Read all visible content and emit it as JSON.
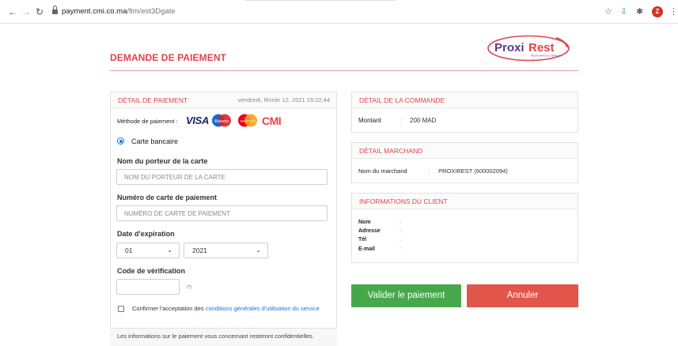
{
  "browser": {
    "url_host": "payment.cmi.co.ma",
    "url_path": "/fim/est3Dgate",
    "avatar_letter": "Z"
  },
  "header": {
    "title": "DEMANDE DE PAIEMENT",
    "logo_text_proxi": "Proxi",
    "logo_text_rest": "Rest",
    "logo_tagline": "RESTAURATION & SERVICES"
  },
  "payment_panel": {
    "heading": "DÉTAIL DE PAIEMENT",
    "date": "vendredi, février 12, 2021 15:22:44",
    "method_label": "Méthode de paiement :",
    "logos": {
      "visa": "VISA",
      "maestro": "Maestro",
      "mastercard": "MasterCard",
      "cmi": "CMI"
    },
    "radio_label": "Carte bancaire",
    "holder_label": "Nom du porteur de la carte",
    "holder_placeholder": "NOM DU PORTEUR DE LA CARTE",
    "card_label": "Numéro de carte de paiement",
    "card_placeholder": "NUMÉRO DE CARTE DE PAIEMENT",
    "expiry_label": "Date d'expiration",
    "expiry_month": "01",
    "expiry_year": "2021",
    "cvv_label": "Code de vérification",
    "cvv_help": "(?)",
    "terms_prefix": "Confirmer l'acceptation des ",
    "terms_link": "conditions générales d'utilisation",
    "terms_suffix": " du service",
    "footer": "Les informations sur le paiement vous concernant resteront confidentielles."
  },
  "order_panel": {
    "heading": "DÉTAIL DE LA COMMANDE",
    "amount_label": "Montant",
    "amount_value": "200 MAD"
  },
  "merchant_panel": {
    "heading": "DÉTAIL MARCHAND",
    "name_label": "Nom du marchand",
    "name_value": "PROXIREST (600002094)"
  },
  "client_panel": {
    "heading": "INFORMATIONS DU CLIENT",
    "fields": [
      {
        "label": "Nom",
        "value": ""
      },
      {
        "label": "Adresse",
        "value": ""
      },
      {
        "label": "Tél",
        "value": ""
      },
      {
        "label": "E-mail",
        "value": ""
      }
    ]
  },
  "actions": {
    "validate": "Valider le paiement",
    "cancel": "Annuler"
  },
  "colors": {
    "accent": "#e2434b",
    "validate": "#47a84b",
    "cancel": "#e2554a",
    "link": "#1a73e8"
  }
}
